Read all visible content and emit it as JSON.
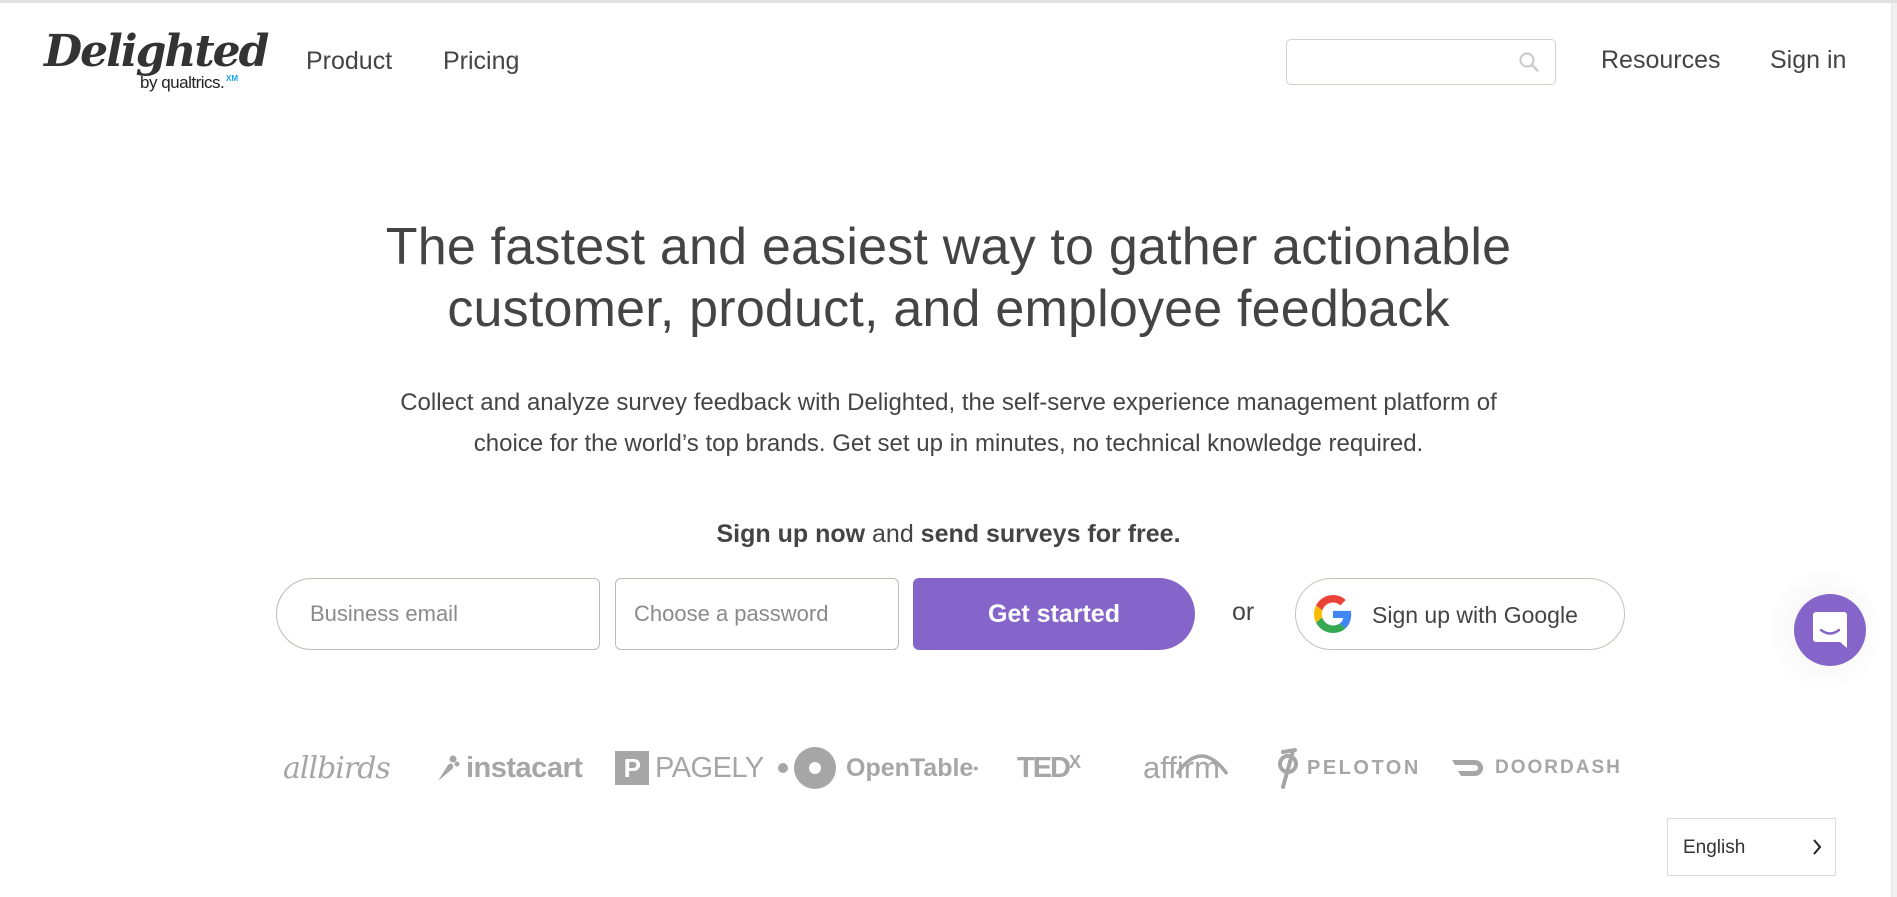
{
  "header": {
    "logo": {
      "name": "Delighted",
      "sub_prefix": "by",
      "sub_brand": "qualtrics.",
      "sub_badge": "XM"
    },
    "nav_left": [
      {
        "label": "Product"
      },
      {
        "label": "Pricing"
      }
    ],
    "search": {
      "value": "",
      "placeholder": "",
      "icon": "search-icon"
    },
    "nav_right": [
      {
        "label": "Resources"
      },
      {
        "label": "Sign in"
      }
    ]
  },
  "hero": {
    "headline_line1": "The fastest and easiest way to gather actionable",
    "headline_line2": "customer, product, and employee feedback",
    "subcopy_line1": "Collect and analyze survey feedback with Delighted, the self-serve experience management platform of",
    "subcopy_line2": "choice for the world’s top brands. Get set up in minutes, no technical knowledge required.",
    "signup_line": {
      "part1": "Sign up now",
      "part2": " and ",
      "part3": "send surveys for free."
    }
  },
  "signup_form": {
    "email": {
      "value": "",
      "placeholder": "Business email"
    },
    "password": {
      "value": "",
      "placeholder": "Choose a password"
    },
    "submit_label": "Get started",
    "or_label": "or",
    "google_label": "Sign up with Google",
    "google_icon": "google-g-icon"
  },
  "chat": {
    "icon": "chat-bubble-icon"
  },
  "customer_logos": [
    {
      "name": "allbirds"
    },
    {
      "name": "instacart"
    },
    {
      "name": "PAGELY",
      "mark": "P"
    },
    {
      "name": "OpenTable",
      "suffix": "•"
    },
    {
      "name": "TED",
      "sup": "X"
    },
    {
      "name": "affirm"
    },
    {
      "name": "PELOTON"
    },
    {
      "name": "DOORDASH"
    }
  ],
  "language_selector": {
    "selected": "English",
    "icon": "chevron-right-icon"
  },
  "colors": {
    "brand_purple": "#8565c9",
    "text": "#444444",
    "logo_gray": "#a6a6a6",
    "qualtrics_xm_blue": "#1aa3e8"
  }
}
